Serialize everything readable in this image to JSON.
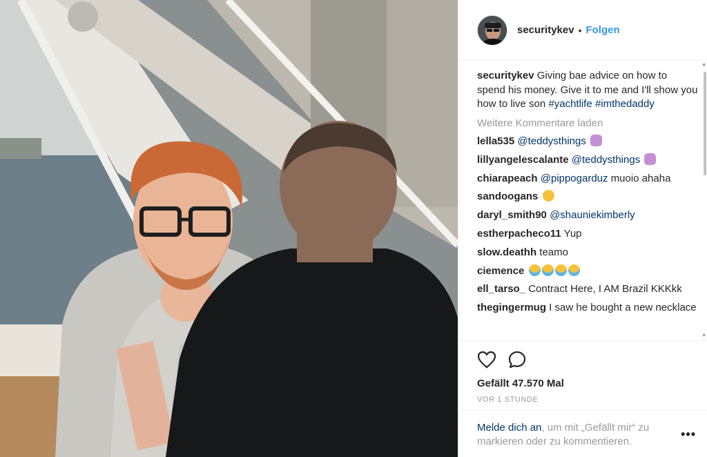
{
  "header": {
    "username": "securitykev",
    "separator": "•",
    "follow_label": "Folgen"
  },
  "caption": {
    "username": "securitykev",
    "text": "Giving bae advice on how to spend his money. Give it to me and I'll show you how to live son",
    "hashtags": [
      "#yachtlife",
      "#imthedaddy"
    ]
  },
  "load_more_label": "Weitere Kommentare laden",
  "comments": [
    {
      "user": "lella535",
      "mention": "@teddysthings",
      "text": "",
      "emoji": [
        "raise"
      ]
    },
    {
      "user": "lillyangelescalante",
      "mention": "@teddysthings",
      "text": "",
      "emoji": [
        "raise"
      ]
    },
    {
      "user": "chiarapeach",
      "mention": "@pippogarduz",
      "text": "muoio ahaha",
      "emoji": []
    },
    {
      "user": "sandoogans",
      "mention": "",
      "text": "",
      "emoji": [
        "laugh"
      ]
    },
    {
      "user": "daryl_smith90",
      "mention": "@shauniekimberly",
      "text": "",
      "emoji": []
    },
    {
      "user": "estherpacheco11",
      "mention": "",
      "text": "Yup",
      "emoji": []
    },
    {
      "user": "slow.deathh",
      "mention": "",
      "text": "teamo",
      "emoji": []
    },
    {
      "user": "ciemence",
      "mention": "",
      "text": "",
      "emoji": [
        "cry",
        "cry",
        "cry",
        "cry"
      ]
    },
    {
      "user": "ell_tarso_",
      "mention": "",
      "text": "Contract Here, I AM Brazil KKKkk",
      "emoji": []
    },
    {
      "user": "thegingermug",
      "mention": "",
      "text": "I saw he bought a new necklace",
      "emoji": []
    }
  ],
  "actions": {
    "like_icon": "heart-icon",
    "comment_icon": "comment-bubble-icon"
  },
  "likes_label": "Gefällt 47.570 Mal",
  "timestamp": "VOR 1 STUNDE",
  "login_prompt": {
    "link": "Melde dich an",
    "text": ", um mit „Gefällt mir“ zu markieren oder zu kommentieren."
  },
  "more_options_label": "•••",
  "colors": {
    "accent": "#3897f0",
    "link": "#003569",
    "muted": "#999999",
    "text": "#262626"
  }
}
